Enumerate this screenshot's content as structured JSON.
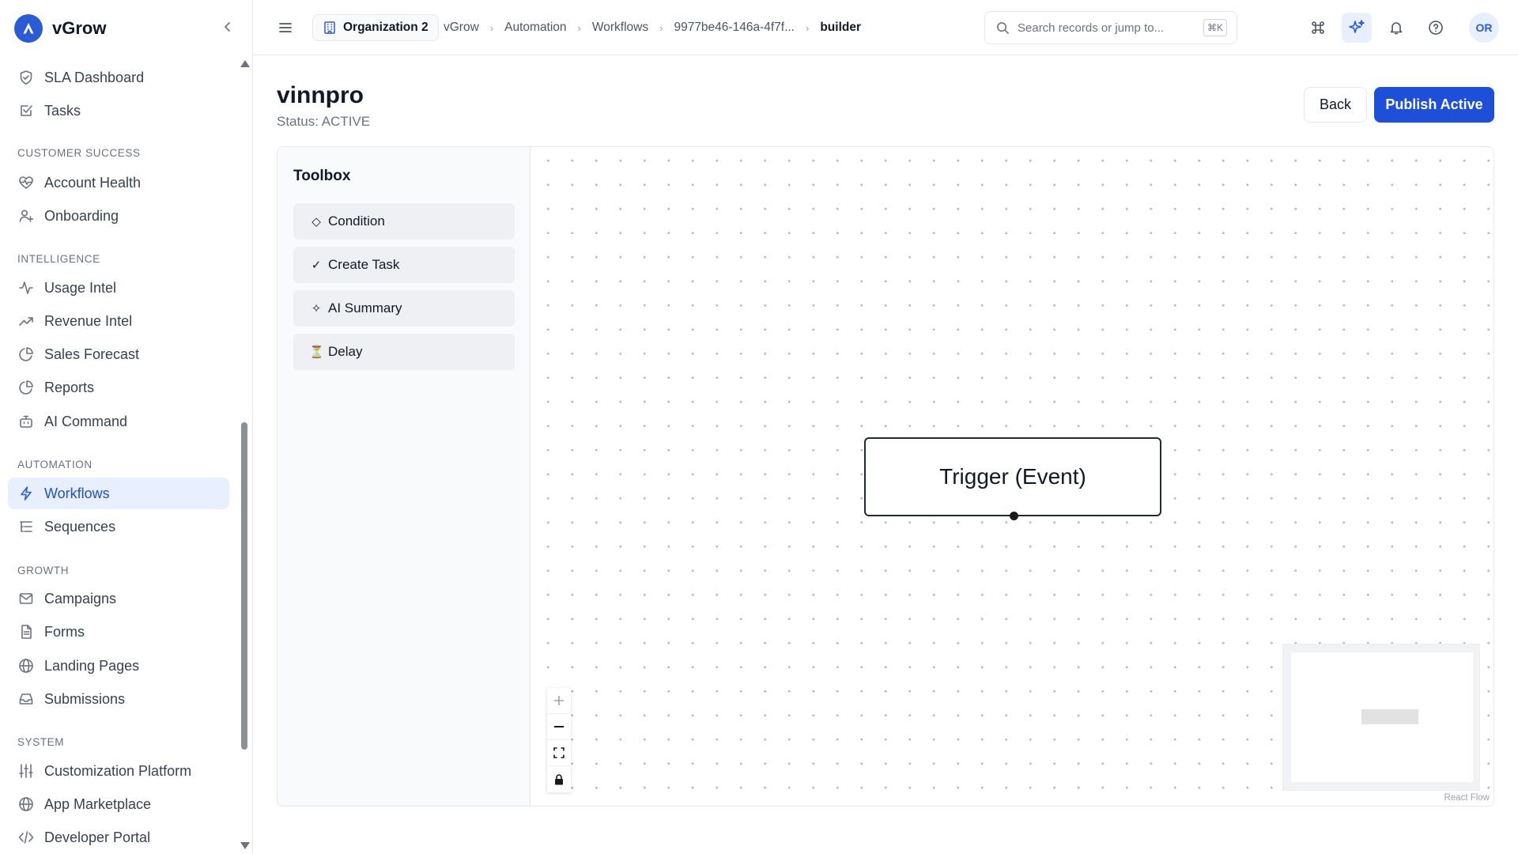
{
  "app": {
    "name": "vGrow",
    "accent": "#2c5bd7"
  },
  "sidebar": {
    "items": [
      {
        "label": "SLA Dashboard",
        "icon": "shield-check-icon"
      },
      {
        "label": "Tasks",
        "icon": "checkbox-icon"
      },
      {
        "label": "Account Health",
        "icon": "heart-pulse-icon"
      },
      {
        "label": "Onboarding",
        "icon": "user-plus-icon"
      },
      {
        "label": "Usage Intel",
        "icon": "activity-icon"
      },
      {
        "label": "Revenue Intel",
        "icon": "trending-up-icon"
      },
      {
        "label": "Sales Forecast",
        "icon": "pie-chart-icon"
      },
      {
        "label": "Reports",
        "icon": "pie-chart-icon"
      },
      {
        "label": "AI Command",
        "icon": "bot-icon"
      },
      {
        "label": "Workflows",
        "icon": "bolt-icon",
        "active": true
      },
      {
        "label": "Sequences",
        "icon": "list-tree-icon"
      },
      {
        "label": "Campaigns",
        "icon": "mail-icon"
      },
      {
        "label": "Forms",
        "icon": "file-text-icon"
      },
      {
        "label": "Landing Pages",
        "icon": "globe-icon"
      },
      {
        "label": "Submissions",
        "icon": "inbox-icon"
      },
      {
        "label": "Customization Platform",
        "icon": "sliders-icon"
      },
      {
        "label": "App Marketplace",
        "icon": "globe-icon"
      },
      {
        "label": "Developer Portal",
        "icon": "code-icon"
      }
    ],
    "sections": {
      "customer_success": "CUSTOMER SUCCESS",
      "intelligence": "INTELLIGENCE",
      "automation": "AUTOMATION",
      "growth": "GROWTH",
      "system": "SYSTEM"
    }
  },
  "topbar": {
    "org": "Organization 2",
    "breadcrumbs": [
      "vGrow",
      "Automation",
      "Workflows",
      "9977be46-146a-4f7f...",
      "builder"
    ],
    "search_placeholder": "Search records or jump to...",
    "search_shortcut": "⌘K",
    "avatar_initials": "OR"
  },
  "page": {
    "title": "vinnpro",
    "status": "Status: ACTIVE",
    "back_label": "Back",
    "publish_label": "Publish Active"
  },
  "toolbox": {
    "title": "Toolbox",
    "items": [
      {
        "glyph": "◇",
        "label": "Condition"
      },
      {
        "glyph": "✓",
        "label": "Create Task"
      },
      {
        "glyph": "✧",
        "label": "AI Summary"
      },
      {
        "glyph": "⏳",
        "label": "Delay"
      }
    ]
  },
  "canvas": {
    "node_label": "Trigger (Event)",
    "attribution": "React Flow"
  }
}
